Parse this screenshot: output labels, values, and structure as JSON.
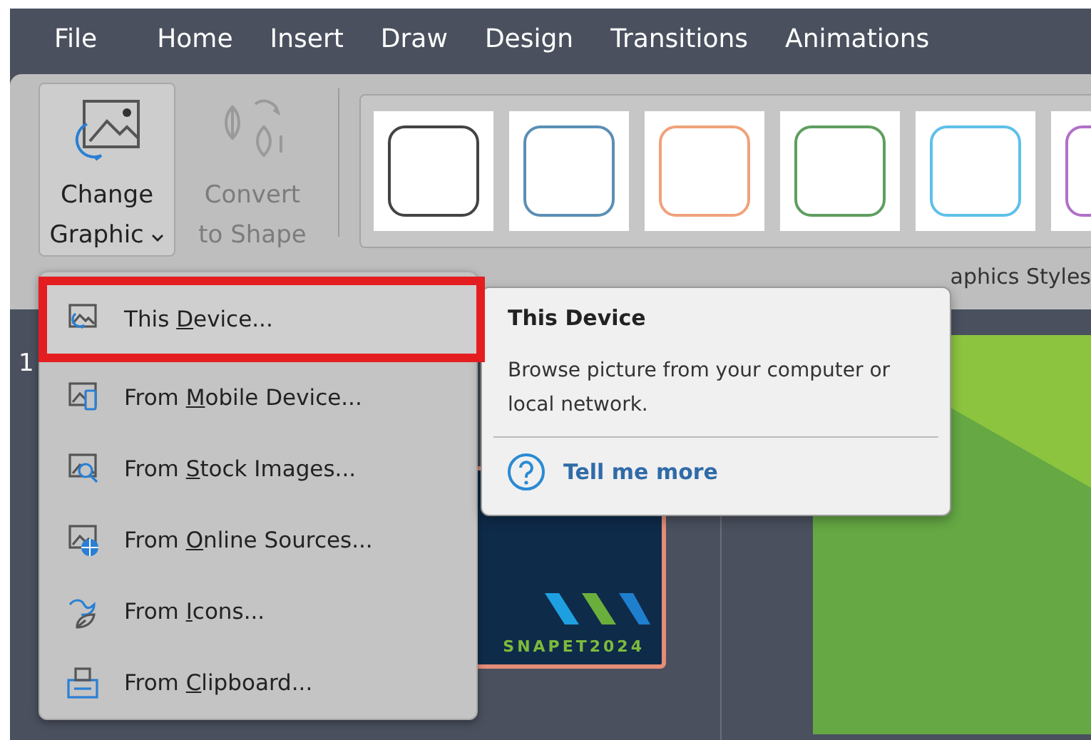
{
  "menu_bar": {
    "tabs": [
      {
        "label": "File",
        "selected": false
      },
      {
        "label": "Home",
        "selected": false
      },
      {
        "label": "Insert",
        "selected": false
      },
      {
        "label": "Draw",
        "selected": false
      },
      {
        "label": "Design",
        "selected": false
      },
      {
        "label": "Transitions",
        "selected": false
      },
      {
        "label": "Animations",
        "selected": false
      }
    ]
  },
  "ribbon": {
    "change_graphic": {
      "line1": "Change",
      "line2": "Graphic",
      "expanded": true
    },
    "convert_to_shape": {
      "line1": "Convert",
      "line2": "to Shape",
      "disabled": true
    },
    "styles_gallery": [
      {
        "color": "#444444"
      },
      {
        "color": "#5b8fb5"
      },
      {
        "color": "#f0a27a"
      },
      {
        "color": "#5f9e5f"
      },
      {
        "color": "#5ec0ea"
      },
      {
        "color": "#b070c8"
      }
    ],
    "group_label": "aphics Styles"
  },
  "slide_pane": {
    "slide_number": "1",
    "thumbnail_text": "SNAPET2024"
  },
  "dropdown": [
    {
      "kind": "device",
      "before": "This ",
      "key": "D",
      "after": "evice...",
      "selected": true
    },
    {
      "kind": "mobile",
      "before": "From ",
      "key": "M",
      "after": "obile Device...",
      "selected": false
    },
    {
      "kind": "stock",
      "before": "From ",
      "key": "S",
      "after": "tock Images...",
      "selected": false
    },
    {
      "kind": "online",
      "before": "From ",
      "key": "O",
      "after": "nline Sources...",
      "selected": false
    },
    {
      "kind": "icons",
      "before": "From ",
      "key": "I",
      "after": "cons...",
      "selected": false
    },
    {
      "kind": "clipboard",
      "before": "From ",
      "key": "C",
      "after": "lipboard...",
      "selected": false
    }
  ],
  "tooltip": {
    "title": "This Device",
    "description": "Browse picture from your computer or local network.",
    "link": "Tell me more"
  }
}
